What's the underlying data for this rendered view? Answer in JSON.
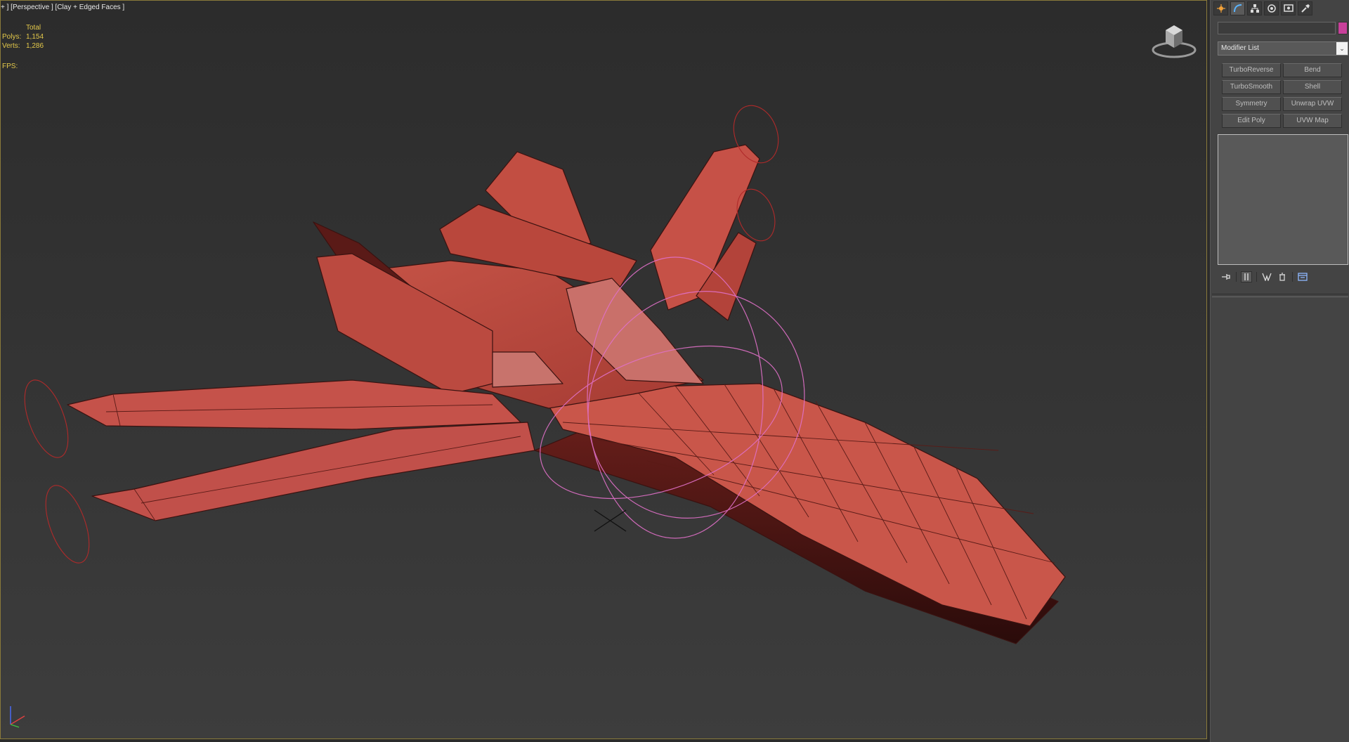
{
  "viewport": {
    "label": "+ ] [Perspective ] [Clay + Edged Faces ]",
    "stats": {
      "header": "Total",
      "polys_label": "Polys:",
      "polys_value": "1,154",
      "verts_label": "Verts:",
      "verts_value": "1,286",
      "fps_label": "FPS:"
    }
  },
  "command_panel": {
    "tabs": [
      {
        "icon": "create-icon"
      },
      {
        "icon": "modify-icon",
        "active": true
      },
      {
        "icon": "hierarchy-icon"
      },
      {
        "icon": "motion-icon"
      },
      {
        "icon": "display-icon"
      },
      {
        "icon": "utilities-icon"
      }
    ],
    "object_name": "",
    "object_color": "#c8409a",
    "modifier_list": "Modifier List",
    "modifier_buttons": [
      "TurboReverse",
      "Bend",
      "TurboSmooth",
      "Shell",
      "Symmetry",
      "Unwrap UVW",
      "Edit Poly",
      "UVW Map"
    ],
    "stack_tools": [
      {
        "icon": "pin-stack-icon"
      },
      {
        "icon": "show-end-result-icon",
        "active": true
      },
      {
        "icon": "make-unique-icon"
      },
      {
        "icon": "remove-modifier-icon"
      },
      {
        "icon": "configure-modifier-sets-icon"
      }
    ]
  },
  "colors": {
    "model": "#b5463d",
    "accent": "#e4c94a",
    "selection": "#e070c8"
  }
}
